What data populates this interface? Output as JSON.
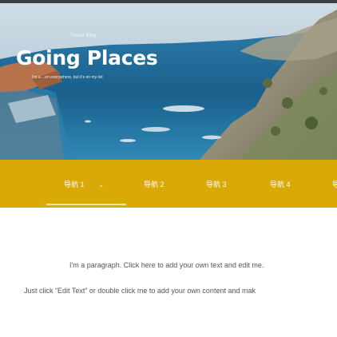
{
  "hero": {
    "blog_tag": "Travel Blog",
    "title": "Going Places",
    "subtitle": "I'm a ...en everywhere, but it's on my list"
  },
  "nav": {
    "items": [
      {
        "label": "导航 1"
      },
      {
        "label": "导航 2"
      },
      {
        "label": "导航 3"
      },
      {
        "label": "导航 4"
      }
    ],
    "dropdown_arrow": "⌄",
    "more_label": "导"
  },
  "content": {
    "paragraph_1": "I'm a paragraph. Click here to add your own text and edit me.",
    "paragraph_2": "Just click “Edit Text” or double click me to add your own content and mak"
  },
  "colors": {
    "nav_background": "#d9a906",
    "sea": "#1e6a96",
    "cliffs": "#9a9378",
    "sky": "#b7cfdc"
  }
}
